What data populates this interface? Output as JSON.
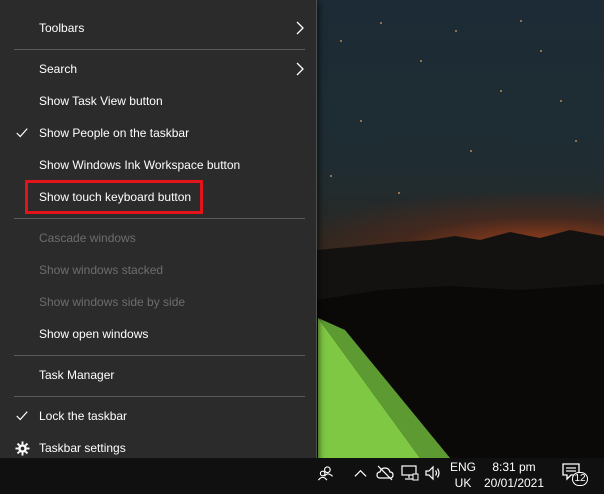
{
  "context_menu": {
    "toolbars": "Toolbars",
    "search": "Search",
    "show_task_view": "Show Task View button",
    "show_people": "Show People on the taskbar",
    "show_ink_workspace": "Show Windows Ink Workspace button",
    "show_touch_keyboard": "Show touch keyboard button",
    "cascade_windows": "Cascade windows",
    "show_windows_stacked": "Show windows stacked",
    "show_windows_side_by_side": "Show windows side by side",
    "show_open_windows": "Show open windows",
    "task_manager": "Task Manager",
    "lock_taskbar": "Lock the taskbar",
    "taskbar_settings": "Taskbar settings"
  },
  "taskbar": {
    "language_code": "ENG",
    "language_region": "UK",
    "time": "8:31 pm",
    "date": "20/01/2021",
    "notification_count": "12"
  },
  "colors": {
    "menu_background": "#2b2b2b",
    "menu_text": "#ffffff",
    "menu_disabled_text": "#6d6d6d",
    "highlight_border": "#e2141a",
    "taskbar_background": "#101010"
  },
  "icons": {
    "submenu_arrow": "chevron-right-icon",
    "checked": "checkmark-icon",
    "settings": "gear-icon",
    "people": "people-icon",
    "show_hidden": "chevron-up-icon",
    "onedrive": "cloud-offline-icon",
    "network": "network-icon",
    "volume": "speaker-icon",
    "notifications": "notification-icon"
  }
}
